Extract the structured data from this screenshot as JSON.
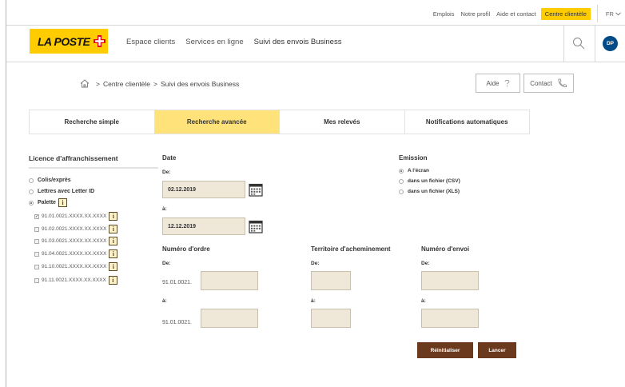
{
  "topbar": {
    "links": [
      "Emplois",
      "Notre profil",
      "Aide et contact"
    ],
    "highlight": "Centre clientèle",
    "lang": "FR"
  },
  "header": {
    "logo_text": "LA POSTE",
    "nav": [
      "Espace clients",
      "Services en ligne",
      "Suivi des envois Business"
    ],
    "avatar": "DP"
  },
  "breadcrumb": {
    "sep": ">",
    "items": [
      "Centre clientèle",
      "Suivi des envois Business"
    ]
  },
  "actions": {
    "aide": "Aide",
    "contact": "Contact"
  },
  "tabs": [
    {
      "label": "Recherche simple",
      "active": false
    },
    {
      "label": "Recherche avancée",
      "active": true
    },
    {
      "label": "Mes relevés",
      "active": false
    },
    {
      "label": "Notifications automatiques",
      "active": false
    }
  ],
  "license": {
    "title": "Licence d'affranchissement",
    "options": [
      {
        "label": "Colis/exprès",
        "selected": false
      },
      {
        "label": "Lettres avec Letter ID",
        "selected": false
      },
      {
        "label": "Palette",
        "selected": true
      }
    ],
    "info_glyph": "i",
    "licences": [
      {
        "label": "91.01.0021.XXXX.XX.XXXX",
        "checked": true
      },
      {
        "label": "91.02.0021.XXXX.XX.XXXX",
        "checked": false
      },
      {
        "label": "91.03.0021.XXXX.XX.XXXX",
        "checked": false
      },
      {
        "label": "91.04.0021.XXXX.XX.XXXX",
        "checked": false
      },
      {
        "label": "91.10.0021.XXXX.XX.XXXX",
        "checked": false
      },
      {
        "label": "91.11.0021.XXXX.XX.XXXX",
        "checked": false
      }
    ]
  },
  "date": {
    "title": "Date",
    "from_label": "De:",
    "from_value": "02.12.2019",
    "to_label": "à:",
    "to_value": "12.12.2019"
  },
  "emission": {
    "title": "Emission",
    "options": [
      {
        "label": "A l'écran",
        "selected": true
      },
      {
        "label": "dans un fichier (CSV)",
        "selected": false
      },
      {
        "label": "dans un fichier (XLS)",
        "selected": false
      }
    ]
  },
  "order": {
    "title": "Numéro d'ordre",
    "from_label": "De:",
    "to_label": "à:",
    "prefix": "91.01.0021."
  },
  "territory": {
    "title": "Territoire d'acheminement",
    "from_label": "De:",
    "to_label": "à:"
  },
  "shipment": {
    "title": "Numéro d'envoi",
    "from_label": "De:",
    "to_label": "à:"
  },
  "buttons": {
    "reset": "Réinitialiser",
    "launch": "Lancer"
  },
  "colors": {
    "brand_yellow": "#ffcc00",
    "active_tab": "#ffe27a",
    "field_bg": "#efe7d8",
    "button_brown": "#6b3a1e",
    "avatar_blue": "#004b87"
  }
}
